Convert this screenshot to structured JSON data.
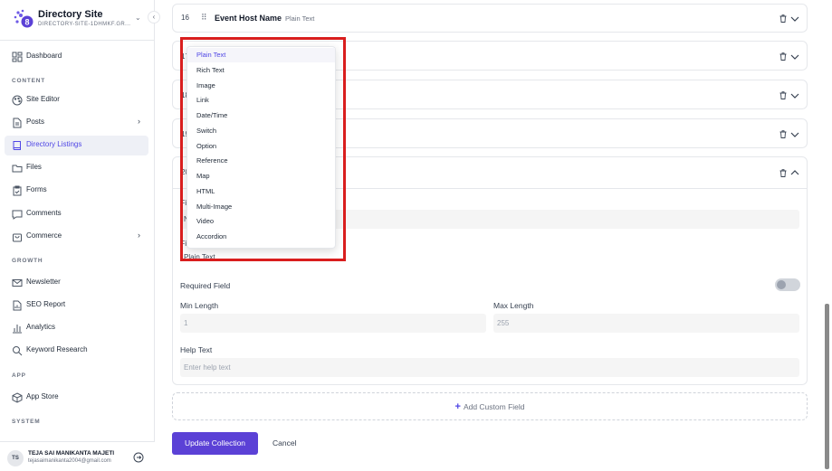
{
  "sidebar": {
    "site_name": "Directory Site",
    "site_id": "DIRECTORY-SITE-1DHMKF.GR...",
    "collapse_glyph": "‹",
    "items": [
      {
        "label": "Dashboard",
        "icon": "dashboard-icon"
      },
      {
        "label": "Site Editor",
        "icon": "palette-icon"
      },
      {
        "label": "Posts",
        "icon": "document-icon"
      },
      {
        "label": "Directory Listings",
        "icon": "book-icon"
      },
      {
        "label": "Files",
        "icon": "folder-icon"
      },
      {
        "label": "Forms",
        "icon": "clipboard-icon"
      },
      {
        "label": "Comments",
        "icon": "comment-icon"
      },
      {
        "label": "Commerce",
        "icon": "bag-icon"
      },
      {
        "label": "Newsletter",
        "icon": "mail-icon"
      },
      {
        "label": "SEO Report",
        "icon": "report-icon"
      },
      {
        "label": "Analytics",
        "icon": "bar-chart-icon"
      },
      {
        "label": "Keyword Research",
        "icon": "search-icon"
      },
      {
        "label": "App Store",
        "icon": "box-icon"
      }
    ],
    "sections": {
      "content": "CONTENT",
      "growth": "GROWTH",
      "app": "APP",
      "system": "SYSTEM"
    },
    "user": {
      "initials": "TS",
      "name": "TEJA SAI MANIKANTA MAJETI",
      "email": "tejasaimanikanta2004@gmail.com"
    }
  },
  "fields": {
    "row16": {
      "number": "16",
      "name": "Event Host Name",
      "type": "Plain Text"
    },
    "row17": {
      "number": "17"
    },
    "row18": {
      "number": "18"
    },
    "row19": {
      "number": "19"
    },
    "row20": {
      "number": "20"
    }
  },
  "editor": {
    "field_name_label_partial": "Fi",
    "name_initial": "N",
    "field_type_label_partial": "Fi",
    "field_type_value": "Plain Text",
    "required_label": "Required Field",
    "min_label": "Min Length",
    "min_value": "1",
    "max_label": "Max Length",
    "max_value": "255",
    "help_label": "Help Text",
    "help_placeholder": "Enter help text"
  },
  "dropdown": {
    "options": [
      "Plain Text",
      "Rich Text",
      "Image",
      "Link",
      "Date/Time",
      "Switch",
      "Option",
      "Reference",
      "Map",
      "HTML",
      "Multi-Image",
      "Video",
      "Accordion"
    ],
    "selected": "Plain Text"
  },
  "actions": {
    "add_custom_field": "Add Custom Field",
    "update": "Update Collection",
    "cancel": "Cancel"
  },
  "colors": {
    "accent": "#5b41d6",
    "highlight": "#d91e1e"
  }
}
